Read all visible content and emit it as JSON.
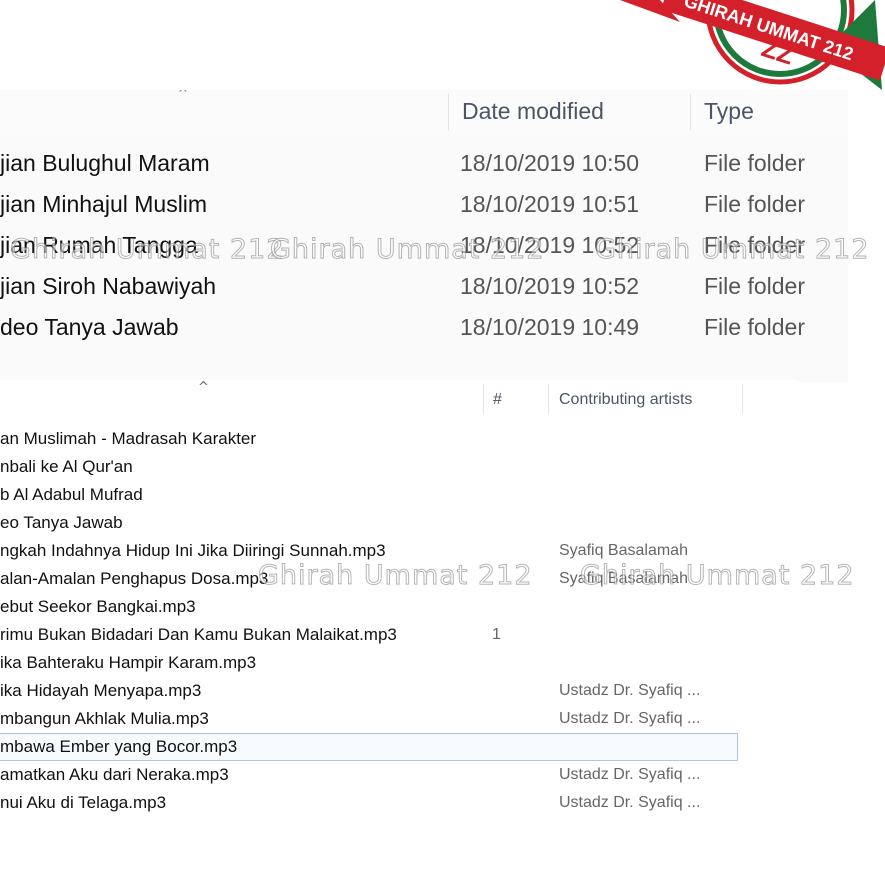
{
  "top_panel": {
    "columns": {
      "date_modified": "Date modified",
      "type": "Type"
    },
    "rows": [
      {
        "name": "jian Bulughul Maram",
        "date": "18/10/2019 10:50",
        "type": "File folder"
      },
      {
        "name": "jian Minhajul Muslim",
        "date": "18/10/2019 10:51",
        "type": "File folder"
      },
      {
        "name": "jian Rumah Tangga",
        "date": "18/10/2019 10:52",
        "type": "File folder"
      },
      {
        "name": "jian Siroh Nabawiyah",
        "date": "18/10/2019 10:52",
        "type": "File folder"
      },
      {
        "name": "deo Tanya Jawab",
        "date": "18/10/2019 10:49",
        "type": "File folder"
      }
    ]
  },
  "bottom_panel": {
    "columns": {
      "number": "#",
      "contributing_artists": "Contributing artists"
    },
    "rows": [
      {
        "name": "an Muslimah - Madrasah Karakter",
        "num": "",
        "artist": ""
      },
      {
        "name": "nbali ke Al Qur'an",
        "num": "",
        "artist": ""
      },
      {
        "name": "b Al Adabul Mufrad",
        "num": "",
        "artist": ""
      },
      {
        "name": "eo Tanya Jawab",
        "num": "",
        "artist": ""
      },
      {
        "name": "ngkah Indahnya Hidup Ini Jika Diiringi Sunnah.mp3",
        "num": "",
        "artist": "Syafiq Basalamah"
      },
      {
        "name": "alan-Amalan Penghapus Dosa.mp3",
        "num": "",
        "artist": "Syafiq Basalamah"
      },
      {
        "name": "ebut Seekor Bangkai.mp3",
        "num": "",
        "artist": ""
      },
      {
        "name": "rimu Bukan Bidadari Dan Kamu Bukan Malaikat.mp3",
        "num": "1",
        "artist": ""
      },
      {
        "name": "ika Bahteraku Hampir Karam.mp3",
        "num": "",
        "artist": ""
      },
      {
        "name": "ika Hidayah Menyapa.mp3",
        "num": "",
        "artist": "Ustadz Dr. Syafiq ..."
      },
      {
        "name": "mbangun Akhlak Mulia.mp3",
        "num": "",
        "artist": "Ustadz Dr. Syafiq ..."
      },
      {
        "name": "mbawa Ember yang Bocor.mp3",
        "num": "",
        "artist": ""
      },
      {
        "name": "amatkan Aku dari Neraka.mp3",
        "num": "",
        "artist": "Ustadz Dr. Syafiq ..."
      },
      {
        "name": "nui Aku di Telaga.mp3",
        "num": "",
        "artist": "Ustadz Dr. Syafiq ..."
      }
    ]
  },
  "watermark": "Ghirah Ummat 212",
  "logo": {
    "text": "GHIRAH UMMAT 212",
    "colors": {
      "red": "#d4202a",
      "green": "#1e7a3c"
    }
  },
  "icons": {
    "sort_indicator": "sort-ascending-icon"
  }
}
